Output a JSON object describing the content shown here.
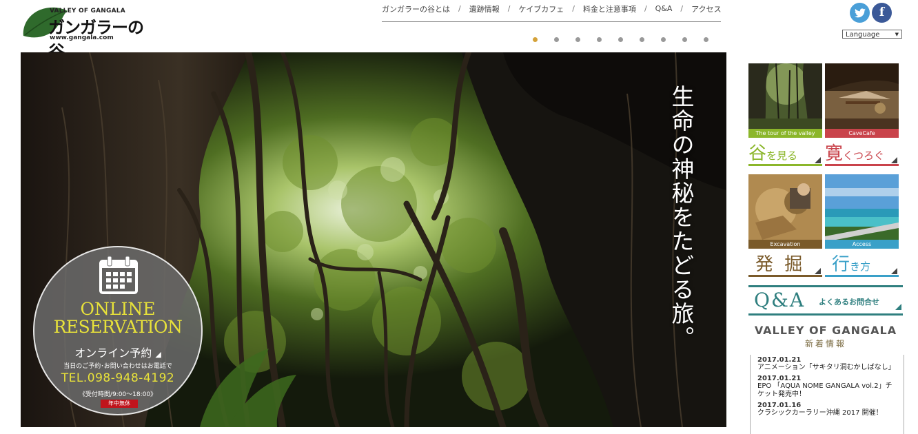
{
  "logo": {
    "small": "VALLEY OF GANGALA",
    "big": "ガンガラーの谷",
    "url": "www.gangala.com"
  },
  "nav": {
    "items": [
      "ガンガラーの谷とは",
      "遺跡情報",
      "ケイブカフェ",
      "料金と注意事項",
      "Q&A",
      "アクセス"
    ],
    "separator": "/"
  },
  "slider": {
    "count": 9,
    "active": 0,
    "active_color": "#d4a23a"
  },
  "social": {
    "twitter": "twitter-icon",
    "facebook": "facebook-icon",
    "facebook_glyph": "f"
  },
  "language": {
    "selected": "Language"
  },
  "hero": {
    "tagline": "生命の神秘をたどる旅。"
  },
  "reservation": {
    "line1": "ONLINE",
    "line2": "RESERVATION",
    "jp": "オンライン予約",
    "sub": "当日のご予約･お問い合わせはお電話で",
    "tel": "TEL.098-948-4192",
    "hours": "《受付時間/9:00〜18:00》",
    "badge": "年中無休"
  },
  "tiles": [
    {
      "caption": "The tour of the valley",
      "big": "谷",
      "rest": "を見る",
      "color": "#8bb62a"
    },
    {
      "caption": "CaveCafe",
      "big": "寛",
      "rest": "くつろぐ",
      "color": "#c9434b"
    },
    {
      "caption": "Excavation",
      "big": "発 掘",
      "rest": "",
      "color": "#7a5a2a"
    },
    {
      "caption": "Access",
      "big": "行",
      "rest": "き方",
      "color": "#3aa0c8"
    }
  ],
  "qa": {
    "big": "Q&A",
    "sub": "よくあるお問合せ",
    "color": "#2f7f7f"
  },
  "news": {
    "title_en": "VALLEY OF GANGALA",
    "title_jp": "新着情報",
    "items": [
      {
        "date": "2017.01.21",
        "title": "アニメーション「サキタリ洞むかしばなし」"
      },
      {
        "date": "2017.01.21",
        "title": "EPO 「AQUA NOME GANGALA vol.2」チケット発売中！"
      },
      {
        "date": "2017.01.16",
        "title": "クラシックカーラリー沖縄 2017 開催！"
      }
    ]
  }
}
